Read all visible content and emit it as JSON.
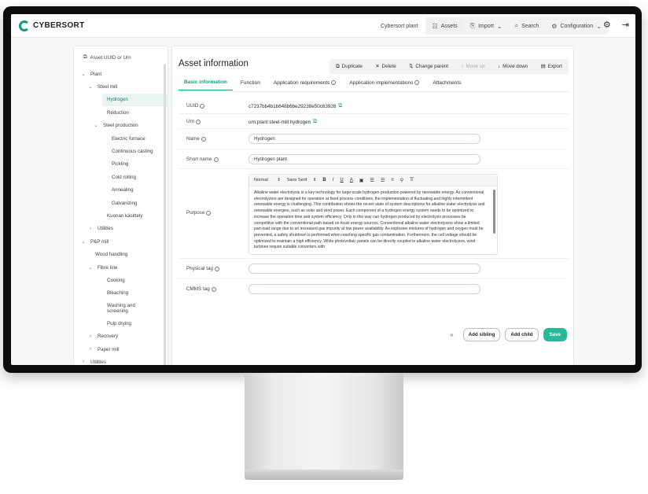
{
  "app": {
    "logo_text": "CYBERSORT",
    "brand_color": "#169b7c"
  },
  "topnav": {
    "site_label": "Cybersort plant",
    "items": [
      {
        "label": "Assets",
        "icon": "grid-icon"
      },
      {
        "label": "Import",
        "icon": "import-icon"
      },
      {
        "label": "Search",
        "icon": "search-icon"
      },
      {
        "label": "Configuration",
        "icon": "gear-icon"
      }
    ]
  },
  "sidebar": {
    "search_label": "Asset UUID or Urn",
    "tree": [
      {
        "label": "Plant",
        "level": 0,
        "chevron": "down"
      },
      {
        "label": "Steel mill",
        "level": 1,
        "chevron": "down"
      },
      {
        "label": "Hydrogen",
        "level": 2,
        "selected": true
      },
      {
        "label": "Reduction",
        "level": 2
      },
      {
        "label": "Steel production",
        "level": 2,
        "chevron": "down"
      },
      {
        "label": "Electric furnace",
        "level": 3
      },
      {
        "label": "Continuous casting",
        "level": 3
      },
      {
        "label": "Pickling",
        "level": 3
      },
      {
        "label": "Cold rolling",
        "level": 3
      },
      {
        "label": "Annealing",
        "level": 3
      },
      {
        "label": "Galvanizing",
        "level": 3
      },
      {
        "label": "Kuonan käsittely",
        "level": 2
      },
      {
        "label": "Utilities",
        "level": 1,
        "chevron": "right"
      },
      {
        "label": "P&P mill",
        "level": 0,
        "chevron": "down"
      },
      {
        "label": "Wood handling",
        "level": 1
      },
      {
        "label": "Fibre line",
        "level": 1,
        "chevron": "down"
      },
      {
        "label": "Cooking",
        "level": 2
      },
      {
        "label": "Bleaching",
        "level": 2
      },
      {
        "label": "Washing and screening",
        "level": 2
      },
      {
        "label": "Pulp drying",
        "level": 2
      },
      {
        "label": "Recovery",
        "level": 1,
        "chevron": "right"
      },
      {
        "label": "Paper mill",
        "level": 1,
        "chevron": "right"
      },
      {
        "label": "Utilities",
        "level": 0,
        "chevron": "right"
      }
    ]
  },
  "main": {
    "title": "Asset information",
    "actions": [
      {
        "label": "Duplicate",
        "icon": "duplicate-icon",
        "enabled": true
      },
      {
        "label": "Delete",
        "icon": "close-icon",
        "enabled": true
      },
      {
        "label": "Change parent",
        "icon": "swap-icon",
        "enabled": true
      },
      {
        "label": "Move up",
        "icon": "arrow-up-icon",
        "enabled": false
      },
      {
        "label": "Move down",
        "icon": "arrow-down-icon",
        "enabled": true
      },
      {
        "label": "Export",
        "icon": "export-icon",
        "enabled": true
      }
    ],
    "tabs": [
      {
        "label": "Basic information",
        "active": true
      },
      {
        "label": "Function"
      },
      {
        "label": "Application requirements",
        "info": true
      },
      {
        "label": "Application implementations",
        "info": true
      },
      {
        "label": "Attachments"
      }
    ],
    "fields": {
      "uuid": {
        "label": "UUID",
        "value": "c7237bb4b1b648b6be29238e50c63926"
      },
      "urn": {
        "label": "Urn",
        "value": "urn:plant:steel-mill:hydrogen"
      },
      "name": {
        "label": "Name",
        "value": "Hydrogen"
      },
      "short_name": {
        "label": "Short name",
        "value": "Hydrogen plant"
      },
      "purpose": {
        "label": "Purpose",
        "toolbar": {
          "format": "Normal",
          "font": "Sans Serif"
        },
        "text": "Alkaline water electrolysis is a key technology for large-scale hydrogen production powered by renewable energy. As conventional electrolyzers are designed for operation at fixed process conditions, the implementation of fluctuating and highly intermittent renewable energy is challenging. This contribution shows the recent state of system descriptions for alkaline water electrolysis and renewable energies, such as solar and wind power. Each component of a hydrogen energy system needs to be optimized to increase the operation time and system efficiency. Only in this way can hydrogen produced by electrolysis processes be competitive with the conventional path based on fossil energy sources. Conventional alkaline water electrolyzers show a limited part-load range due to an increased gas impurity at low power availability. As explosive mixtures of hydrogen and oxygen must be prevented, a safety shutdown is performed when reaching specific gas contamination. Furthermore, the cell voltage should be optimized to maintain a high efficiency. While photovoltaic panels can be directly coupled to alkaline water electrolyzers, wind turbines require suitable converters with"
      },
      "physical_tag": {
        "label": "Physical tag",
        "value": ""
      },
      "cmms_tag": {
        "label": "CMMS tag",
        "value": ""
      }
    },
    "buttons": {
      "add_sibling": "Add sibling",
      "add_child": "Add child",
      "save": "Save"
    }
  }
}
